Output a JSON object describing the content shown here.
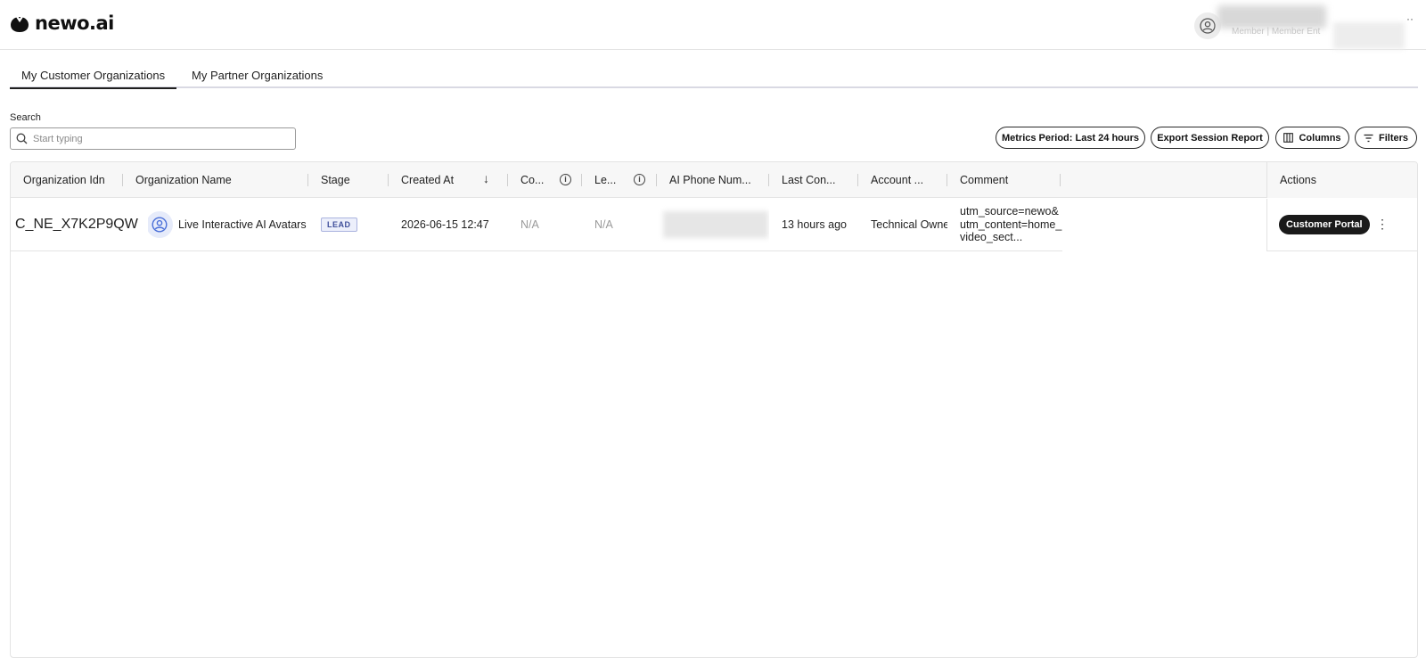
{
  "header": {
    "brand": "newo.ai",
    "user_subtitle": "Member | Member Ent"
  },
  "tabs": [
    {
      "label": "My Customer Organizations",
      "active": true
    },
    {
      "label": "My Partner Organizations",
      "active": false
    }
  ],
  "search": {
    "label": "Search",
    "placeholder": "Start typing"
  },
  "toolbar": {
    "metrics_label": "Metrics Period: Last 24 hours",
    "export_label": "Export Session Report",
    "columns_label": "Columns",
    "filters_label": "Filters"
  },
  "table": {
    "columns": [
      "Organization Idn",
      "Organization Name",
      "Stage",
      "Created At",
      "Co...",
      "Le...",
      "AI Phone Num...",
      "Last Con...",
      "Account ...",
      "Comment"
    ],
    "actions_header": "Actions",
    "sorted_column": "Created At",
    "sort_direction": "descending",
    "rows": [
      {
        "idn": "C_NE_X7K2P9QW",
        "name": "Live Interactive AI Avatars",
        "stage": "LEAD",
        "created_at": "2026-06-15 12:47",
        "co": "N/A",
        "le": "N/A",
        "last_contact": "13 hours ago",
        "account": "Technical Owner",
        "comment": "utm_source=newo&utm_content=home_video_sect...",
        "action_label": "Customer Portal"
      }
    ]
  },
  "colors": {
    "accent_dark": "#1a1a1a",
    "badge_text": "#3f4f9a",
    "org_icon": "#4a6fd8"
  },
  "icons": [
    "search-icon",
    "columns-icon",
    "filter-icon",
    "info-icon",
    "sort-down-icon",
    "user-icon",
    "more-vertical-icon"
  ]
}
